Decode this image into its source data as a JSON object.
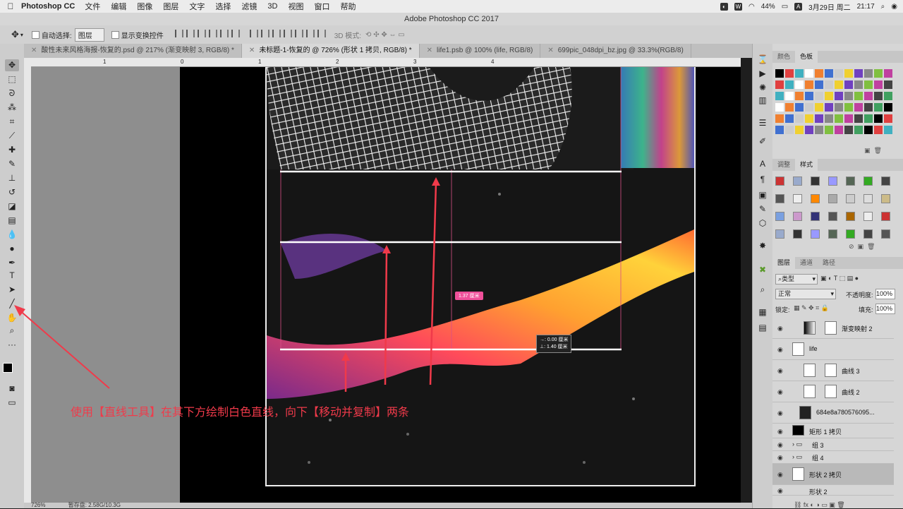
{
  "menubar": {
    "app": "Photoshop CC",
    "items": [
      "文件",
      "编辑",
      "图像",
      "图层",
      "文字",
      "选择",
      "滤镜",
      "3D",
      "视图",
      "窗口",
      "帮助"
    ],
    "battery": "44%",
    "date": "3月29日 周二",
    "time": "21:17"
  },
  "window_title": "Adobe Photoshop CC 2017",
  "options": {
    "auto_select": "自动选择:",
    "auto_select_value": "图层",
    "show_transform": "显示变换控件",
    "mode_3d": "3D 模式:"
  },
  "tabs": [
    {
      "label": "酸性未来风格海报-恢复的.psd @ 217% (渐变映射 3, RGB/8) *"
    },
    {
      "label": "未标题-1-恢复的 @ 726% (形状 1 拷贝, RGB/8) *"
    },
    {
      "label": "life1.psb @ 100% (life, RGB/8)"
    },
    {
      "label": "699pic_048dpi_bz.jpg @ 33.3%(RGB/8)"
    }
  ],
  "ruler_labels": [
    "1",
    "0",
    "1",
    "2",
    "3",
    "4"
  ],
  "canvas": {
    "width_label": "1.37 厘米",
    "move_x": "→: 0.00 厘米",
    "move_y": "⊥: 1.40 厘米"
  },
  "annotation": "使用【直线工具】在其下方绘制白色直线，向下【移动并复制】两条",
  "status": {
    "zoom": "726%",
    "doc": "暂存盘: 2.58G/10.3G"
  },
  "panels": {
    "color_tabs": [
      "颜色",
      "色板"
    ],
    "adjust_tabs": [
      "调整",
      "样式"
    ],
    "layer_tabs": [
      "图层",
      "通道",
      "路径"
    ],
    "filter_kind": "类型",
    "blend_mode": "正常",
    "opacity_label": "不透明度:",
    "opacity_value": "100%",
    "lock_label": "锁定:",
    "fill_label": "填充:",
    "fill_value": "100%"
  },
  "layers": [
    {
      "name": "渐变映射 2"
    },
    {
      "name": "life"
    },
    {
      "name": "曲线 3"
    },
    {
      "name": "曲线 2"
    },
    {
      "name": "684e8a780576095..."
    },
    {
      "name": "矩形 1 拷贝"
    },
    {
      "name": "组 3"
    },
    {
      "name": "组 4"
    },
    {
      "name": "形状 2 拷贝"
    },
    {
      "name": "形状 2"
    }
  ],
  "colors": {
    "annotation": "#f03a4a",
    "guide": "#d94f86",
    "badge": "#f0509a"
  },
  "icons": [
    "apple-icon",
    "move-icon",
    "marquee-icon",
    "lasso-icon",
    "magic-wand-icon",
    "crop-icon",
    "eyedropper-icon",
    "brush-icon",
    "eraser-icon",
    "text-icon",
    "pen-icon",
    "line-icon",
    "hand-icon",
    "zoom-icon",
    "eye-icon"
  ]
}
